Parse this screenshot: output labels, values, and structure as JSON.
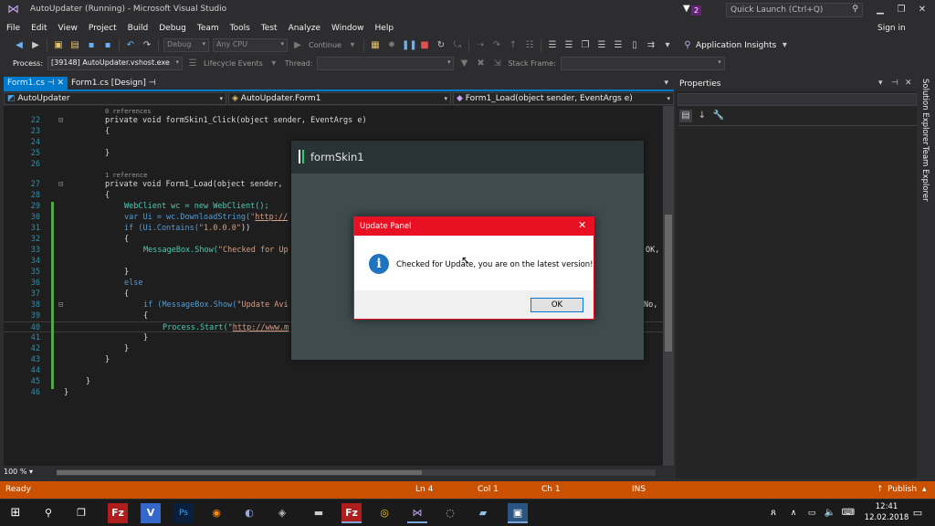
{
  "window": {
    "title": "AutoUpdater (Running) - Microsoft Visual Studio",
    "notification_count": "2",
    "quick_launch_placeholder": "Quick Launch (Ctrl+Q)",
    "sign_in": "Sign in"
  },
  "menu": [
    "File",
    "Edit",
    "View",
    "Project",
    "Build",
    "Debug",
    "Team",
    "Tools",
    "Test",
    "Analyze",
    "Window",
    "Help"
  ],
  "toolbar": {
    "config": "Debug",
    "platform": "Any CPU",
    "continue": "Continue",
    "app_insights": "Application Insights"
  },
  "debug_toolbar": {
    "process_label": "Process:",
    "process_value": "[39148] AutoUpdater.vshost.exe",
    "lifecycle": "Lifecycle Events",
    "thread_label": "Thread:",
    "stack_frame_label": "Stack Frame:"
  },
  "tabs": [
    {
      "label": "Form1.cs",
      "active": true
    },
    {
      "label": "Form1.cs [Design]",
      "active": false
    }
  ],
  "navbar": {
    "project": "AutoUpdater",
    "class": "AutoUpdater.Form1",
    "member": "Form1_Load(object sender, EventArgs e)"
  },
  "code": {
    "refs0": "0 references",
    "l22": "private void formSkin1_Click(object sender, EventArgs e)",
    "l23": "{",
    "l25": "}",
    "refs1": "1 reference",
    "l27": "private void Form1_Load(object sender,",
    "l28": "{",
    "l29": "WebClient wc = new WebClient();",
    "l30a": "var Ui = wc.DownloadString(\"",
    "l30b": "http://",
    "l31a": "if (Ui.Contains(",
    "l31b": "\"1.0.0.0\"",
    "l31c": "))",
    "l32": "{",
    "l33a": "MessageBox.Show(",
    "l33b": "\"Checked for Up",
    "l33c": "OK,",
    "l35": "}",
    "l36": "else",
    "l37": "{",
    "l38a": "if (MessageBox.Show(",
    "l38b": "\"Update Avi",
    "l38c": "No,",
    "l39": "{",
    "l40a": "Process.Start(\"",
    "l40b": "http://www.m",
    "l41": "}",
    "l42": "}",
    "l43": "}",
    "l45": "}",
    "l46": "}"
  },
  "line_numbers": [
    "22",
    "23",
    "24",
    "25",
    "26",
    "27",
    "28",
    "29",
    "30",
    "31",
    "32",
    "33",
    "34",
    "35",
    "36",
    "37",
    "38",
    "39",
    "40",
    "41",
    "42",
    "43",
    "44",
    "45",
    "46"
  ],
  "zoom": "100 %",
  "properties": {
    "title": "Properties"
  },
  "side_tabs": [
    "Solution Explorer",
    "Team Explorer"
  ],
  "status": {
    "ready": "Ready",
    "ln": "Ln 4",
    "col": "Col 1",
    "ch": "Ch 1",
    "ins": "INS",
    "publish": "Publish"
  },
  "taskbar": {
    "time": "12:41",
    "date": "12.02.2018"
  },
  "form": {
    "title": "formSkin1"
  },
  "msgbox": {
    "title": "Update Panel",
    "text": "Checked for Update, you are on the latest version!",
    "ok": "OK"
  },
  "colors": {
    "accent": "#007acc",
    "status": "#ca5100",
    "dialog_title": "#e81123"
  }
}
